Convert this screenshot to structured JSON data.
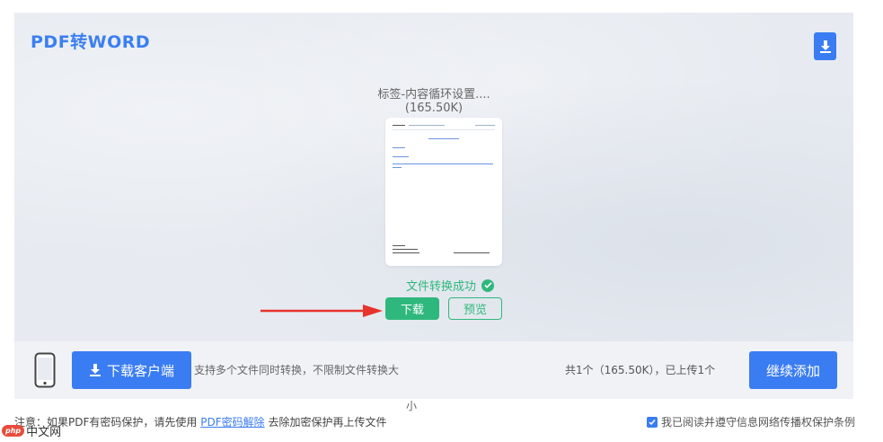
{
  "header": {
    "title": "PDF转WORD",
    "download_icon": "download-icon"
  },
  "file": {
    "name": "标签-内容循环设置....",
    "size": "(165.50K)",
    "status": "文件转换成功"
  },
  "actions": {
    "download_label": "下载",
    "preview_label": "预览"
  },
  "bottom_bar": {
    "client_label": "下载客户端",
    "support_text": "支持多个文件同时转换，不限制文件转换大",
    "support_wrap": "小",
    "count_text": "共1个（165.50K），已上传1个",
    "continue_label": "继续添加"
  },
  "notice": {
    "prefix": "注意：如果PDF有密码保护，请先使用",
    "link": "PDF密码解除",
    "suffix": "去除加密保护再上传文件"
  },
  "agreement": {
    "label": "我已阅读并遵守信息网络传播权保护条例",
    "checked": true
  },
  "watermark": {
    "badge": "php",
    "text": "中文网"
  },
  "colors": {
    "accent": "#3a7cf2",
    "success": "#2fb87d",
    "arrow": "#e8322c"
  }
}
